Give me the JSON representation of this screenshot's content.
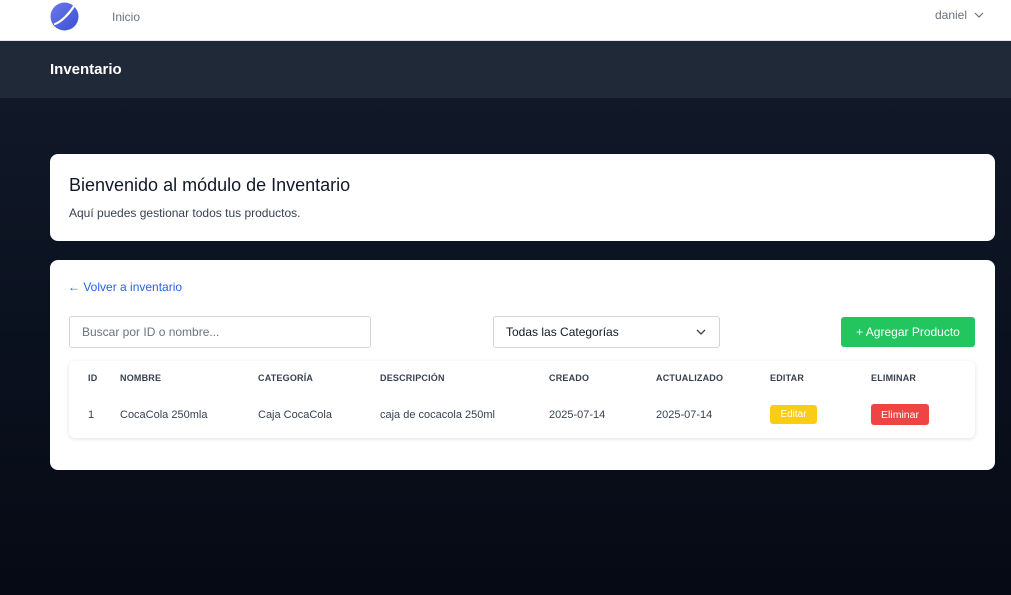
{
  "nav": {
    "home_label": "Inicio",
    "user_name": "daniel",
    "logo_icon": "app-logo-icon",
    "user_menu_icon": "chevron-down-icon"
  },
  "header": {
    "title": "Inventario"
  },
  "welcome": {
    "title": "Bienvenido al módulo de Inventario",
    "subtitle": "Aquí puedes gestionar todos tus productos."
  },
  "toolbar": {
    "back_link": "← Volver a inventario",
    "search_placeholder": "Buscar por ID o nombre...",
    "search_value": "",
    "category_selected": "Todas las Categorías",
    "add_button": "+ Agregar Producto"
  },
  "table": {
    "headers": [
      "ID",
      "NOMBRE",
      "CATEGORÍA",
      "DESCRIPCIÓN",
      "CREADO",
      "ACTUALIZADO",
      "EDITAR",
      "ELIMINAR"
    ],
    "rows": [
      {
        "id": "1",
        "nombre": "CocaCola 250mla",
        "categoria": "Caja CocaCola",
        "descripcion": "caja de cocacola 250ml",
        "creado": "2025-07-14",
        "actualizado": "2025-07-14",
        "edit_label": "Editar",
        "delete_label": "Eliminar"
      }
    ]
  },
  "colors": {
    "primary": "#2563eb",
    "success": "#22c55e",
    "warning": "#facc15",
    "danger": "#ef4444",
    "header_bg": "#1f2937"
  }
}
